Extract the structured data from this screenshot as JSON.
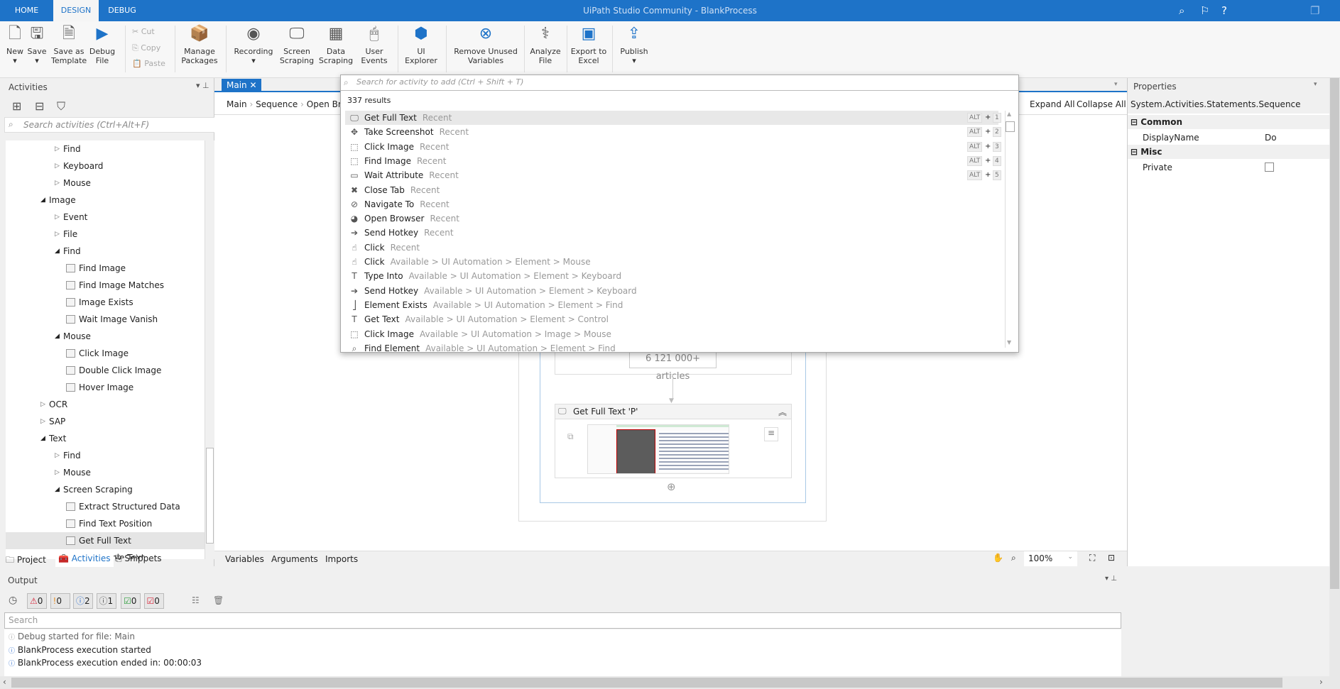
{
  "titlebar": {
    "tabs": [
      "HOME",
      "DESIGN",
      "DEBUG"
    ],
    "active_tab": "DESIGN",
    "title": "UiPath Studio Community - BlankProcess",
    "icons": [
      "search-icon",
      "feedback-icon",
      "help-icon",
      "restore-icon"
    ]
  },
  "ribbon": {
    "new": "New",
    "save": "Save",
    "save_template": "Save as Template",
    "debug_file": "Debug File",
    "cut": "Cut",
    "copy": "Copy",
    "paste": "Paste",
    "manage_packages": "Manage Packages",
    "recording": "Recording",
    "screen_scraping": "Screen Scraping",
    "data_scraping": "Data Scraping",
    "user_events": "User Events",
    "ui_explorer": "UI Explorer",
    "remove_unused": "Remove Unused Variables",
    "analyze_file": "Analyze File",
    "export_excel": "Export to Excel",
    "publish": "Publish"
  },
  "activities": {
    "title": "Activities",
    "search_placeholder": "Search activities (Ctrl+Alt+F)",
    "tree": [
      {
        "label": "Find",
        "level": 2,
        "type": "collapsed"
      },
      {
        "label": "Keyboard",
        "level": 2,
        "type": "collapsed"
      },
      {
        "label": "Mouse",
        "level": 2,
        "type": "collapsed"
      },
      {
        "label": "Image",
        "level": 1,
        "type": "expanded"
      },
      {
        "label": "Event",
        "level": 2,
        "type": "collapsed"
      },
      {
        "label": "File",
        "level": 2,
        "type": "collapsed"
      },
      {
        "label": "Find",
        "level": 2,
        "type": "expanded"
      },
      {
        "label": "Find Image",
        "level": 3,
        "type": "leaf"
      },
      {
        "label": "Find Image Matches",
        "level": 3,
        "type": "leaf"
      },
      {
        "label": "Image Exists",
        "level": 3,
        "type": "leaf"
      },
      {
        "label": "Wait Image Vanish",
        "level": 3,
        "type": "leaf"
      },
      {
        "label": "Mouse",
        "level": 2,
        "type": "expanded"
      },
      {
        "label": "Click Image",
        "level": 3,
        "type": "leaf"
      },
      {
        "label": "Double Click Image",
        "level": 3,
        "type": "leaf"
      },
      {
        "label": "Hover Image",
        "level": 3,
        "type": "leaf"
      },
      {
        "label": "OCR",
        "level": 1,
        "type": "collapsed"
      },
      {
        "label": "SAP",
        "level": 1,
        "type": "collapsed"
      },
      {
        "label": "Text",
        "level": 1,
        "type": "expanded"
      },
      {
        "label": "Find",
        "level": 2,
        "type": "collapsed"
      },
      {
        "label": "Mouse",
        "level": 2,
        "type": "collapsed"
      },
      {
        "label": "Screen Scraping",
        "level": 2,
        "type": "expanded"
      },
      {
        "label": "Extract Structured Data",
        "level": 3,
        "type": "leaf"
      },
      {
        "label": "Find Text Position",
        "level": 3,
        "type": "leaf"
      },
      {
        "label": "Get Full Text",
        "level": 3,
        "type": "leaf",
        "selected": true
      },
      {
        "label": "Get Visible Text",
        "level": 3,
        "type": "leaf"
      }
    ],
    "bottom_tabs": [
      "Project",
      "Activities",
      "Snippets"
    ],
    "active_bottom_tab": "Activities"
  },
  "designer": {
    "tab": "Main",
    "breadcrumb": [
      "Main",
      "Sequence",
      "Open Br"
    ],
    "expand_all": "Expand All",
    "collapse_all": "Collapse All",
    "article_text": "6 121 000+ articles",
    "activity_title": "Get Full Text 'P'",
    "bottom_tabs": [
      "Variables",
      "Arguments",
      "Imports"
    ],
    "zoom": "100%"
  },
  "dropdown": {
    "placeholder": "Search for activity to add (Ctrl + Shift + T)",
    "count": "337 results",
    "results": [
      {
        "name": "Get Full Text",
        "cat": "Recent",
        "icon": "monitor-icon",
        "shortcut": "1"
      },
      {
        "name": "Take Screenshot",
        "cat": "Recent",
        "icon": "screenshot-icon",
        "shortcut": "2"
      },
      {
        "name": "Click Image",
        "cat": "Recent",
        "icon": "click-image-icon",
        "shortcut": "3"
      },
      {
        "name": "Find Image",
        "cat": "Recent",
        "icon": "find-image-icon",
        "shortcut": "4"
      },
      {
        "name": "Wait Attribute",
        "cat": "Recent",
        "icon": "attribute-icon",
        "shortcut": "5"
      },
      {
        "name": "Close Tab",
        "cat": "Recent",
        "icon": "close-tab-icon"
      },
      {
        "name": "Navigate To",
        "cat": "Recent",
        "icon": "compass-icon"
      },
      {
        "name": "Open Browser",
        "cat": "Recent",
        "icon": "globe-icon"
      },
      {
        "name": "Send Hotkey",
        "cat": "Recent",
        "icon": "hotkey-icon"
      },
      {
        "name": "Click",
        "cat": "Recent",
        "icon": "click-icon"
      },
      {
        "name": "Click",
        "cat": "Available > UI Automation > Element > Mouse",
        "icon": "click-icon"
      },
      {
        "name": "Type Into",
        "cat": "Available > UI Automation > Element > Keyboard",
        "icon": "type-into-icon"
      },
      {
        "name": "Send Hotkey",
        "cat": "Available > UI Automation > Element > Keyboard",
        "icon": "hotkey-icon"
      },
      {
        "name": "Element Exists",
        "cat": "Available > UI Automation > Element > Find",
        "icon": "element-exists-icon"
      },
      {
        "name": "Get Text",
        "cat": "Available > UI Automation > Element > Control",
        "icon": "get-text-icon"
      },
      {
        "name": "Click Image",
        "cat": "Available > UI Automation > Image > Mouse",
        "icon": "click-image-icon"
      },
      {
        "name": "Find Element",
        "cat": "Available > UI Automation > Element > Find",
        "icon": "search-icon"
      }
    ],
    "alt": "ALT",
    "plus": "+"
  },
  "properties": {
    "title": "Properties",
    "type": "System.Activities.Statements.Sequence",
    "groups": [
      {
        "name": "Common",
        "rows": [
          {
            "key": "DisplayName",
            "value": "Do"
          }
        ]
      },
      {
        "name": "Misc",
        "rows": [
          {
            "key": "Private",
            "value": ""
          }
        ]
      }
    ]
  },
  "output": {
    "title": "Output",
    "counters": [
      {
        "icon": "error-icon",
        "value": "0",
        "color": "#d9253a"
      },
      {
        "icon": "warning-icon",
        "value": "0",
        "color": "#e8912a"
      },
      {
        "icon": "info-icon",
        "value": "2",
        "color": "#2f6fd0"
      },
      {
        "icon": "trace-icon",
        "value": "1",
        "color": "#555555"
      },
      {
        "icon": "success-icon",
        "value": "0",
        "color": "#2e9e3c"
      },
      {
        "icon": "fail-icon",
        "value": "0",
        "color": "#d9253a"
      }
    ],
    "search_placeholder": "Search",
    "lines": [
      "Debug started for file: Main",
      "BlankProcess execution started",
      "BlankProcess execution ended in: 00:00:03"
    ]
  },
  "colors": {
    "accent": "#1e73c8"
  }
}
